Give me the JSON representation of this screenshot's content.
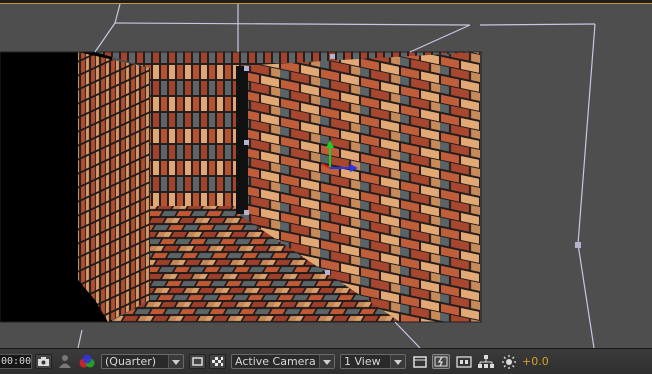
{
  "toolbar": {
    "timecode": "00:00",
    "resolution": "(Quarter)",
    "camera_view": "Active Camera",
    "view_layout": "1 View",
    "exposure": "+0.0"
  },
  "icons": [
    "snapshot-camera-icon",
    "show-snapshot-icon",
    "channel-rgb-icon",
    "region-of-interest-icon",
    "transparency-grid-icon",
    "draft-3d-icon",
    "fast-previews-icon",
    "timeline-icon",
    "flowchart-icon",
    "reset-exposure-icon"
  ],
  "colors": {
    "panel_bg": "#4e4e4e",
    "exposure_text": "#d7a21f",
    "axis_y": "#22cc22",
    "axis_x": "#2a36e6",
    "axis_z": "#e02020"
  }
}
